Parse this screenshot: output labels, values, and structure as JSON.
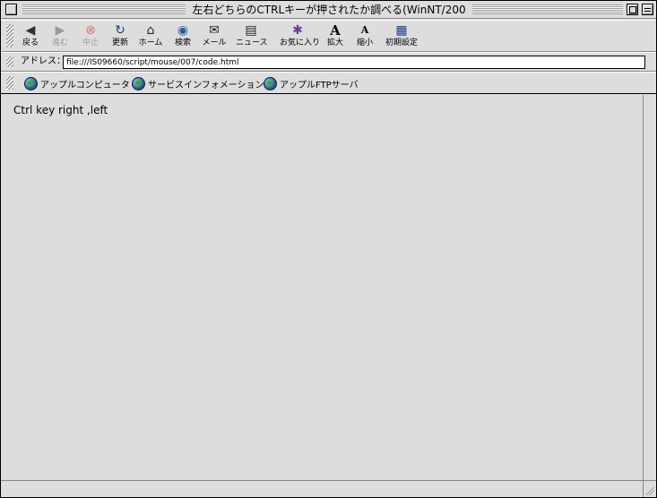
{
  "window": {
    "title": "左右どちらのCTRLキーが押されたか調べる(WinNT/200"
  },
  "toolbar": {
    "buttons": [
      {
        "label": "戻る",
        "icon": "back-arrow-icon",
        "glyph": "◀",
        "color": "#333333"
      },
      {
        "label": "進む",
        "icon": "forward-arrow-icon",
        "glyph": "▶",
        "color": "#999999"
      },
      {
        "label": "中止",
        "icon": "stop-icon",
        "glyph": "⊗",
        "color": "#e07070"
      },
      {
        "label": "更新",
        "icon": "refresh-icon",
        "glyph": "↻",
        "color": "#1a3a8a"
      },
      {
        "label": "ホーム",
        "icon": "home-icon",
        "glyph": "⌂",
        "color": "#222222"
      },
      {
        "label": "検索",
        "icon": "search-globe-icon",
        "glyph": "◉",
        "color": "#2a5a9a"
      },
      {
        "label": "メール",
        "icon": "mail-icon",
        "glyph": "✉",
        "color": "#222222"
      },
      {
        "label": "ニュース",
        "icon": "news-icon",
        "glyph": "▤",
        "color": "#222222"
      },
      {
        "label": "お気に入り",
        "icon": "favorites-icon",
        "glyph": "✱",
        "color": "#6a3aa0"
      },
      {
        "label": "拡大",
        "icon": "text-larger-icon",
        "glyph": "A",
        "color": "#000000"
      },
      {
        "label": "縮小",
        "icon": "text-smaller-icon",
        "glyph": "a",
        "color": "#000000"
      },
      {
        "label": "初期設定",
        "icon": "preferences-icon",
        "glyph": "▦",
        "color": "#1a3a8a"
      }
    ]
  },
  "address": {
    "label": "アドレス：",
    "value": "file:///IS09660/script/mouse/007/code.html"
  },
  "favorites": [
    {
      "label": "アップルコンピュータ"
    },
    {
      "label": "サービスインフォメーション"
    },
    {
      "label": "アップルFTPサーバ"
    }
  ],
  "content": {
    "text": "Ctrl key right ,left"
  }
}
